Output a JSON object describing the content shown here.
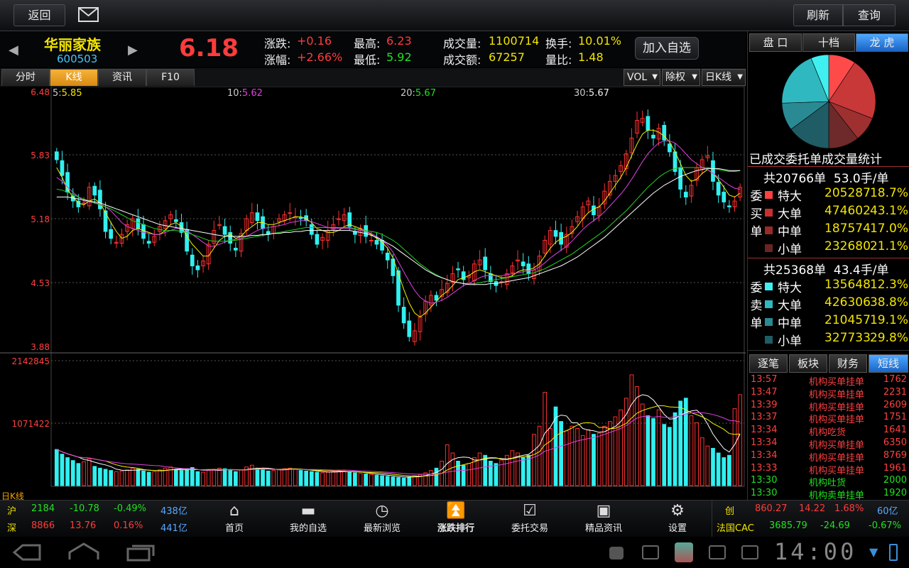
{
  "topbar": {
    "back_label": "返回",
    "mail_icon": "mail-icon",
    "refresh_label": "刷新",
    "query_label": "查询"
  },
  "stock": {
    "name": "华丽家族",
    "code": "600503",
    "price": "6.18",
    "change_label": "涨跌:",
    "change": "+0.16",
    "pct_label": "涨幅:",
    "pct": "+2.66%",
    "high_label": "最高:",
    "high": "6.23",
    "low_label": "最低:",
    "low": "5.92",
    "vol_label": "成交量:",
    "vol": "1100714",
    "amt_label": "成交额:",
    "amt": "67257",
    "turnover_label": "换手:",
    "turnover": "10.01%",
    "ratio_label": "量比:",
    "ratio": "1.48",
    "add_watch_label": "加入自选"
  },
  "chart_tabs": [
    "分时",
    "K线",
    "资讯",
    "F10"
  ],
  "chart_dropdowns": [
    "VOL",
    "除权",
    "日K线"
  ],
  "ma": {
    "ma5_label": "5:",
    "ma5": "5.85",
    "ma10_label": "10:",
    "ma10": "5.62",
    "ma20_label": "20:",
    "ma20": "5.67",
    "ma30_label": "30:",
    "ma30": "5.67"
  },
  "right_panel": {
    "tabs": [
      "盘 口",
      "十档",
      "龙 虎"
    ],
    "pie_title": "已成交委托单成交量统计",
    "buy": {
      "side_label": "委买单",
      "summary": "共20766单  53.0手/单",
      "rows": [
        {
          "label": "特大",
          "value": "205287",
          "pct": "18.7%"
        },
        {
          "label": "大单",
          "value": "474602",
          "pct": "43.1%"
        },
        {
          "label": "中单",
          "value": "187574",
          "pct": "17.0%"
        },
        {
          "label": "小单",
          "value": "232680",
          "pct": "21.1%"
        }
      ]
    },
    "sell": {
      "side_label": "委卖单",
      "summary": "共25368单  43.4手/单",
      "rows": [
        {
          "label": "特大",
          "value": "135648",
          "pct": "12.3%"
        },
        {
          "label": "大单",
          "value": "426306",
          "pct": "38.8%"
        },
        {
          "label": "中单",
          "value": "210457",
          "pct": "19.1%"
        },
        {
          "label": "小单",
          "value": "327733",
          "pct": "29.8%"
        }
      ]
    },
    "feed_tabs": [
      "逐笔",
      "板块",
      "财务",
      "短线"
    ],
    "feed": [
      {
        "time": "13:57",
        "type": "机构买单挂单",
        "vol": "1762",
        "c": "red"
      },
      {
        "time": "13:47",
        "type": "机构买单挂单",
        "vol": "2231",
        "c": "red"
      },
      {
        "time": "13:39",
        "type": "机构买单挂单",
        "vol": "2609",
        "c": "red"
      },
      {
        "time": "13:37",
        "type": "机构买单挂单",
        "vol": "1751",
        "c": "red"
      },
      {
        "time": "13:34",
        "type": "机构吃货",
        "vol": "1641",
        "c": "red"
      },
      {
        "time": "13:34",
        "type": "机构买单挂单",
        "vol": "6350",
        "c": "red"
      },
      {
        "time": "13:34",
        "type": "机构买单挂单",
        "vol": "8769",
        "c": "red"
      },
      {
        "time": "13:33",
        "type": "机构买单挂单",
        "vol": "1961",
        "c": "red"
      },
      {
        "time": "13:30",
        "type": "机构吐货",
        "vol": "2000",
        "c": "grn"
      },
      {
        "time": "13:30",
        "type": "机构卖单挂单",
        "vol": "1920",
        "c": "grn"
      }
    ]
  },
  "index": {
    "sh": {
      "label": "沪",
      "value": "2184",
      "chg": "-10.78",
      "pct": "-0.49%",
      "amt": "438亿"
    },
    "sz": {
      "label": "深",
      "value": "8866",
      "chg": "13.76",
      "pct": "0.16%",
      "amt": "441亿"
    },
    "cy": {
      "label": "创",
      "value": "860.27",
      "chg": "14.22",
      "pct": "1.68%",
      "amt": "60亿"
    },
    "cac": {
      "label": "法国CAC",
      "value": "3685.79",
      "chg": "-24.69",
      "pct": "-0.67%"
    }
  },
  "nav": [
    {
      "label": "首页",
      "icon": "home-icon"
    },
    {
      "label": "我的自选",
      "icon": "folder-icon"
    },
    {
      "label": "最新浏览",
      "icon": "clock-icon"
    },
    {
      "label": "涨跌排行",
      "icon": "double-up-icon"
    },
    {
      "label": "委托交易",
      "icon": "check-icon"
    },
    {
      "label": "精品资讯",
      "icon": "new-icon"
    },
    {
      "label": "设置",
      "icon": "gear-icon"
    }
  ],
  "system": {
    "clock": "14:00"
  },
  "chart_data": {
    "type": "candlestick",
    "period_label": "日K线",
    "price_ticks": [
      "6.48",
      "5.83",
      "5.18",
      "4.53",
      "3.88"
    ],
    "vol_ticks": [
      "2142845",
      "1071422"
    ],
    "ylim": [
      3.88,
      6.48
    ],
    "vol_max": 2142845,
    "series_close": [
      5.78,
      5.62,
      5.45,
      5.36,
      5.3,
      5.34,
      5.5,
      5.42,
      5.28,
      5.05,
      4.98,
      4.94,
      5.02,
      5.12,
      5.18,
      5.08,
      4.98,
      4.93,
      5.0,
      5.1,
      5.16,
      5.22,
      5.15,
      5.04,
      4.85,
      4.7,
      4.66,
      4.75,
      4.92,
      5.06,
      5.12,
      5.02,
      4.93,
      4.86,
      5.03,
      5.18,
      5.24,
      5.16,
      5.08,
      5.02,
      5.1,
      5.18,
      5.22,
      5.24,
      5.2,
      5.18,
      5.16,
      5.02,
      4.92,
      4.99,
      5.06,
      5.12,
      5.18,
      5.22,
      5.1,
      5.02,
      5.08,
      5.0,
      4.96,
      4.92,
      4.86,
      4.76,
      4.6,
      4.3,
      4.12,
      3.98,
      4.04,
      4.18,
      4.34,
      4.4,
      4.35,
      4.46,
      4.52,
      4.62,
      4.66,
      4.56,
      4.6,
      4.72,
      4.76,
      4.66,
      4.54,
      4.5,
      4.54,
      4.62,
      4.7,
      4.76,
      4.7,
      4.62,
      4.66,
      4.8,
      4.96,
      5.06,
      5.0,
      4.92,
      5.02,
      5.1,
      5.2,
      5.3,
      5.36,
      5.22,
      5.3,
      5.46,
      5.56,
      5.62,
      5.72,
      5.84,
      6.0,
      6.18,
      6.2,
      6.08,
      6.0,
      6.1,
      5.98,
      5.86,
      5.66,
      5.48,
      5.4,
      5.52,
      5.7,
      5.78,
      5.82,
      5.56,
      5.42,
      5.35,
      5.3,
      5.36,
      5.5
    ],
    "ma5": [
      5.7,
      5.6,
      5.48,
      5.4,
      5.34,
      5.32,
      5.36,
      5.38,
      5.34,
      5.24,
      5.14,
      5.05,
      4.98,
      5.0,
      5.06,
      5.08,
      5.06,
      5.04,
      5.02,
      5.02,
      5.06,
      5.12,
      5.14,
      5.1,
      5.0,
      4.92,
      4.86,
      4.8,
      4.8,
      4.88,
      4.96,
      5.0,
      5.02,
      4.98,
      5.0,
      5.06,
      5.1,
      5.14,
      5.14,
      5.12,
      5.12,
      5.14,
      5.16,
      5.18,
      5.2,
      5.2,
      5.18,
      5.14,
      5.08,
      5.06,
      5.04,
      5.04,
      5.06,
      5.1,
      5.12,
      5.1,
      5.08,
      5.05,
      5.02,
      4.98,
      4.94,
      4.88,
      4.78,
      4.62,
      4.46,
      4.32,
      4.22,
      4.18,
      4.22,
      4.28,
      4.34,
      4.4,
      4.44,
      4.5,
      4.56,
      4.58,
      4.6,
      4.64,
      4.66,
      4.64,
      4.62,
      4.6,
      4.58,
      4.58,
      4.6,
      4.64,
      4.66,
      4.66,
      4.68,
      4.72,
      4.8,
      4.88,
      4.94,
      4.98,
      5.0,
      5.04,
      5.1,
      5.18,
      5.24,
      5.28,
      5.3,
      5.36,
      5.44,
      5.52,
      5.6,
      5.7,
      5.82,
      5.94,
      6.04,
      6.08,
      6.08,
      6.06,
      6.02,
      5.96,
      5.86,
      5.74,
      5.62,
      5.56,
      5.58,
      5.64,
      5.68,
      5.64,
      5.58,
      5.5,
      5.42,
      5.4,
      5.44
    ],
    "ma10": [
      5.6,
      5.56,
      5.5,
      5.45,
      5.4,
      5.36,
      5.35,
      5.34,
      5.33,
      5.3,
      5.26,
      5.2,
      5.14,
      5.1,
      5.08,
      5.06,
      5.04,
      5.03,
      5.02,
      5.02,
      5.04,
      5.06,
      5.08,
      5.08,
      5.06,
      5.02,
      4.98,
      4.94,
      4.9,
      4.9,
      4.92,
      4.94,
      4.96,
      4.97,
      4.98,
      5.0,
      5.03,
      5.06,
      5.08,
      5.09,
      5.1,
      5.11,
      5.12,
      5.14,
      5.15,
      5.16,
      5.16,
      5.15,
      5.13,
      5.11,
      5.09,
      5.08,
      5.08,
      5.08,
      5.08,
      5.07,
      5.06,
      5.05,
      5.03,
      5.0,
      4.96,
      4.91,
      4.84,
      4.74,
      4.64,
      4.54,
      4.45,
      4.38,
      4.34,
      4.32,
      4.33,
      4.35,
      4.38,
      4.42,
      4.46,
      4.5,
      4.52,
      4.55,
      4.58,
      4.6,
      4.6,
      4.6,
      4.6,
      4.61,
      4.62,
      4.63,
      4.64,
      4.65,
      4.66,
      4.69,
      4.73,
      4.78,
      4.82,
      4.86,
      4.9,
      4.95,
      5.01,
      5.07,
      5.12,
      5.16,
      5.2,
      5.25,
      5.31,
      5.37,
      5.43,
      5.5,
      5.58,
      5.67,
      5.76,
      5.84,
      5.9,
      5.95,
      5.97,
      5.97,
      5.95,
      5.9,
      5.84,
      5.78,
      5.74,
      5.7,
      5.68,
      5.64,
      5.6,
      5.56,
      5.52,
      5.49,
      5.48
    ],
    "ma20": [
      5.48,
      5.47,
      5.45,
      5.43,
      5.4,
      5.38,
      5.36,
      5.34,
      5.32,
      5.3,
      5.28,
      5.25,
      5.22,
      5.19,
      5.16,
      5.14,
      5.12,
      5.1,
      5.08,
      5.07,
      5.06,
      5.06,
      5.06,
      5.05,
      5.04,
      5.02,
      5.0,
      4.98,
      4.96,
      4.95,
      4.95,
      4.95,
      4.96,
      4.96,
      4.97,
      4.98,
      4.99,
      5.0,
      5.01,
      5.02,
      5.03,
      5.04,
      5.05,
      5.06,
      5.07,
      5.08,
      5.09,
      5.09,
      5.09,
      5.09,
      5.09,
      5.09,
      5.09,
      5.09,
      5.09,
      5.08,
      5.07,
      5.06,
      5.05,
      5.04,
      5.02,
      4.99,
      4.96,
      4.92,
      4.87,
      4.82,
      4.77,
      4.72,
      4.68,
      4.64,
      4.61,
      4.58,
      4.56,
      4.54,
      4.53,
      4.52,
      4.52,
      4.52,
      4.53,
      4.54,
      4.55,
      4.56,
      4.57,
      4.58,
      4.59,
      4.6,
      4.61,
      4.62,
      4.63,
      4.65,
      4.67,
      4.7,
      4.73,
      4.76,
      4.79,
      4.82,
      4.86,
      4.9,
      4.94,
      4.98,
      5.02,
      5.06,
      5.11,
      5.16,
      5.21,
      5.26,
      5.32,
      5.38,
      5.44,
      5.5,
      5.55,
      5.6,
      5.64,
      5.67,
      5.69,
      5.7,
      5.7,
      5.7,
      5.7,
      5.7,
      5.7,
      5.69,
      5.68,
      5.67,
      5.66,
      5.66,
      5.67
    ],
    "ma30": [
      5.4,
      5.4,
      5.4,
      5.39,
      5.38,
      5.37,
      5.36,
      5.35,
      5.34,
      5.32,
      5.3,
      5.28,
      5.26,
      5.24,
      5.22,
      5.2,
      5.18,
      5.16,
      5.14,
      5.12,
      5.11,
      5.1,
      5.09,
      5.08,
      5.07,
      5.06,
      5.05,
      5.04,
      5.03,
      5.02,
      5.01,
      5.0,
      5.0,
      5.0,
      5.0,
      5.0,
      5.01,
      5.01,
      5.02,
      5.02,
      5.03,
      5.03,
      5.04,
      5.04,
      5.05,
      5.05,
      5.06,
      5.06,
      5.06,
      5.06,
      5.06,
      5.06,
      5.06,
      5.06,
      5.06,
      5.05,
      5.04,
      5.03,
      5.01,
      4.99,
      4.96,
      4.93,
      4.9,
      4.86,
      4.82,
      4.78,
      4.74,
      4.7,
      4.66,
      4.63,
      4.6,
      4.58,
      4.56,
      4.54,
      4.53,
      4.52,
      4.51,
      4.51,
      4.51,
      4.51,
      4.52,
      4.52,
      4.53,
      4.54,
      4.55,
      4.56,
      4.57,
      4.58,
      4.6,
      4.62,
      4.64,
      4.66,
      4.68,
      4.7,
      4.73,
      4.76,
      4.79,
      4.83,
      4.87,
      4.91,
      4.95,
      4.99,
      5.04,
      5.09,
      5.14,
      5.19,
      5.24,
      5.29,
      5.34,
      5.39,
      5.44,
      5.48,
      5.52,
      5.55,
      5.58,
      5.61,
      5.63,
      5.65,
      5.67,
      5.68,
      5.69,
      5.69,
      5.69,
      5.68,
      5.67,
      5.67,
      5.67
    ],
    "volume": [
      620000,
      540000,
      480000,
      430000,
      380000,
      410000,
      460000,
      330000,
      300000,
      280000,
      260000,
      240000,
      250000,
      270000,
      300000,
      280000,
      250000,
      230000,
      240000,
      270000,
      300000,
      320000,
      280000,
      260000,
      290000,
      310000,
      240000,
      230000,
      260000,
      280000,
      300000,
      290000,
      260000,
      240000,
      270000,
      320000,
      350000,
      300000,
      270000,
      250000,
      260000,
      280000,
      290000,
      300000,
      280000,
      260000,
      250000,
      240000,
      230000,
      220000,
      230000,
      240000,
      260000,
      250000,
      230000,
      220000,
      210000,
      200000,
      190000,
      180000,
      170000,
      160000,
      150000,
      140000,
      130000,
      150000,
      170000,
      190000,
      220000,
      260000,
      300000,
      420000,
      700000,
      560000,
      420000,
      350000,
      380000,
      480000,
      560000,
      520000,
      420000,
      380000,
      440000,
      520000,
      600000,
      560000,
      480000,
      520000,
      880000,
      1020000,
      1600000,
      980000,
      1350000,
      1100000,
      940000,
      1020000,
      980000,
      860000,
      960000,
      880000,
      900000,
      1020000,
      1100000,
      1180000,
      1300000,
      1500000,
      1900000,
      1700000,
      1400000,
      1200000,
      1150000,
      1300000,
      1050000,
      1000000,
      1250000,
      1450000,
      1500000,
      1200000,
      1080000,
      820000,
      680000,
      640000,
      560000,
      480000,
      520000,
      1320000,
      1560000
    ]
  }
}
